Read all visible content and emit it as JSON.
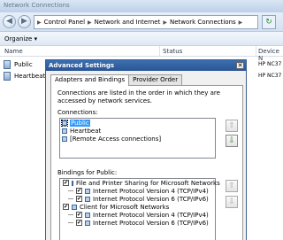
{
  "window": {
    "title": "Network Connections"
  },
  "nav": {
    "back": "◀",
    "forward": "▶"
  },
  "address": {
    "crumbs": [
      "Control Panel",
      "Network and Internet",
      "Network Connections"
    ],
    "refresh": "↻"
  },
  "toolbar": {
    "organize": "Organize ▾"
  },
  "columns": [
    "Name",
    "Status",
    "Device N"
  ],
  "connections": [
    {
      "name": "Public",
      "device": "HP NC37"
    },
    {
      "name": "Heartbeat",
      "device": "HP NC37"
    }
  ],
  "dialog": {
    "title": "Advanced Settings",
    "close": "✕",
    "tabs": [
      "Adapters and Bindings",
      "Provider Order"
    ],
    "description": "Connections are listed in the order in which they are accessed by network services.",
    "connections_label": "Connections:",
    "connections_list": [
      "Public",
      "Heartbeat",
      "[Remote Access connections]"
    ],
    "bindings_label": "Bindings for Public:",
    "bindings": [
      {
        "label": "File and Printer Sharing for Microsoft Networks",
        "level": 0
      },
      {
        "label": "Internet Protocol Version 4 (TCP/IPv4)",
        "level": 1
      },
      {
        "label": "Internet Protocol Version 6 (TCP/IPv6)",
        "level": 1
      },
      {
        "label": "Client for Microsoft Networks",
        "level": 0
      },
      {
        "label": "Internet Protocol Version 4 (TCP/IPv4)",
        "level": 1
      },
      {
        "label": "Internet Protocol Version 6 (TCP/IPv6)",
        "level": 1
      }
    ],
    "move_up": "⇧",
    "move_down": "⇩"
  }
}
